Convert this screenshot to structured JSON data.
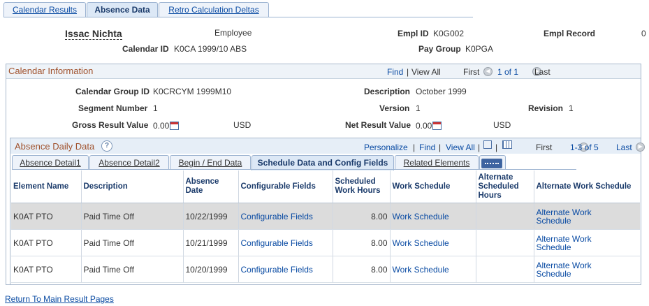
{
  "tabs": [
    {
      "label": "Calendar Results",
      "active": false
    },
    {
      "label": "Absence Data",
      "active": true
    },
    {
      "label": "Retro Calculation Deltas",
      "active": false
    }
  ],
  "header": {
    "name": "Issac Nichta",
    "employee_label": "Employee",
    "empl_id_label": "Empl ID",
    "empl_id_value": "K0G002",
    "empl_record_label": "Empl Record",
    "empl_record_value": "0",
    "calendar_id_label": "Calendar ID",
    "calendar_id_value": "K0CA 1999/10 ABS",
    "pay_group_label": "Pay Group",
    "pay_group_value": "K0PGA"
  },
  "calendar_info": {
    "title": "Calendar Information",
    "find": "Find",
    "separator": "|",
    "view_all": "View All",
    "first": "First",
    "range": "1 of 1",
    "last": "Last",
    "calendar_group_id_label": "Calendar Group ID",
    "calendar_group_id_value": "K0CRCYM 1999M10",
    "description_label": "Description",
    "description_value": "October 1999",
    "segment_number_label": "Segment Number",
    "segment_number_value": "1",
    "version_label": "Version",
    "version_value": "1",
    "revision_label": "Revision",
    "revision_value": "1",
    "gross_label": "Gross Result Value",
    "gross_value": "0.00",
    "gross_currency": "USD",
    "net_label": "Net Result Value",
    "net_value": "0.00",
    "net_currency": "USD"
  },
  "absence_grid": {
    "title": "Absence Daily Data",
    "help": "?",
    "personalize": "Personalize",
    "find": "Find",
    "view_all": "View All",
    "first": "First",
    "range": "1-3 of 5",
    "last": "Last",
    "subtabs": [
      {
        "label": "Absence Detail1",
        "active": false
      },
      {
        "label": "Absence Detail2",
        "active": false
      },
      {
        "label": "Begin / End Data",
        "active": false
      },
      {
        "label": "Schedule Data and Config Fields",
        "active": true
      },
      {
        "label": "Related Elements",
        "active": false
      }
    ],
    "columns": {
      "element_name": "Element Name",
      "description": "Description",
      "absence_date_1": "Absence",
      "absence_date_2": "Date",
      "configurable_fields": "Configurable Fields",
      "scheduled_hours_1": "Scheduled",
      "scheduled_hours_2": "Work Hours",
      "work_schedule": "Work Schedule",
      "alt_hours_1": "Alternate",
      "alt_hours_2": "Scheduled",
      "alt_hours_3": "Hours",
      "alt_work_schedule": "Alternate Work Schedule"
    },
    "rows": [
      {
        "element": "K0AT PTO",
        "description": "Paid Time Off",
        "date": "10/22/1999",
        "config": "Configurable Fields",
        "hours": "8.00",
        "work_schedule": "Work Schedule",
        "alt_hours": "",
        "alt_ws_1": "Alternate Work",
        "alt_ws_2": "Schedule"
      },
      {
        "element": "K0AT PTO",
        "description": "Paid Time Off",
        "date": "10/21/1999",
        "config": "Configurable Fields",
        "hours": "8.00",
        "work_schedule": "Work Schedule",
        "alt_hours": "",
        "alt_ws_1": "Alternate Work",
        "alt_ws_2": "Schedule"
      },
      {
        "element": "K0AT PTO",
        "description": "Paid Time Off",
        "date": "10/20/1999",
        "config": "Configurable Fields",
        "hours": "8.00",
        "work_schedule": "Work Schedule",
        "alt_hours": "",
        "alt_ws_1": "Alternate Work",
        "alt_ws_2": "Schedule"
      }
    ]
  },
  "footer": {
    "return_link": "Return To Main Result Pages"
  }
}
